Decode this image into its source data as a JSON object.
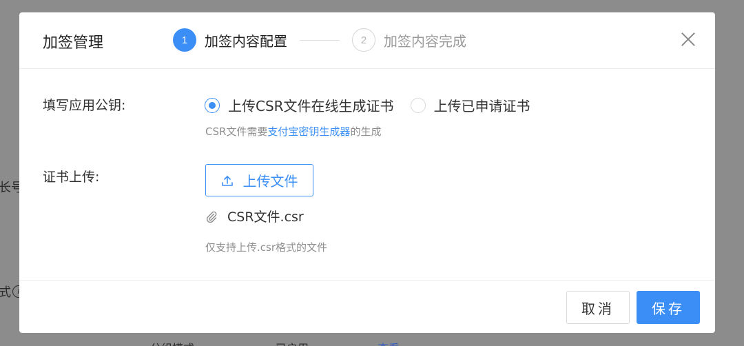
{
  "background": {
    "frag_a": "长号",
    "frag_b": "式",
    "info_icon_glyph": "i",
    "bottom_texts": [
      "分组模式",
      "已启用",
      "查看"
    ]
  },
  "modal": {
    "title": "加签管理",
    "steps": [
      {
        "number": "1",
        "label": "加签内容配置",
        "state": "active"
      },
      {
        "number": "2",
        "label": "加签内容完成",
        "state": "pending"
      }
    ],
    "form": {
      "public_key_label": "填写应用公钥:",
      "radio_options": [
        {
          "label": "上传CSR文件在线生成证书",
          "checked": true
        },
        {
          "label": "上传已申请证书",
          "checked": false
        }
      ],
      "hint_prefix": "CSR文件需要",
      "hint_link": "支付宝密钥生成器",
      "hint_suffix": "的生成",
      "cert_upload_label": "证书上传:",
      "upload_button_label": "上传文件",
      "uploaded_file": "CSR文件.csr",
      "upload_hint": "仅支持上传.csr格式的文件"
    },
    "footer": {
      "cancel_label": "取消",
      "save_label": "保存"
    }
  },
  "colors": {
    "accent": "#3a8ef6",
    "mask": "#8c8c8c"
  },
  "icons": {
    "close": "close-icon",
    "upload": "upload-icon",
    "attachment": "paperclip-icon",
    "info": "info-icon"
  }
}
